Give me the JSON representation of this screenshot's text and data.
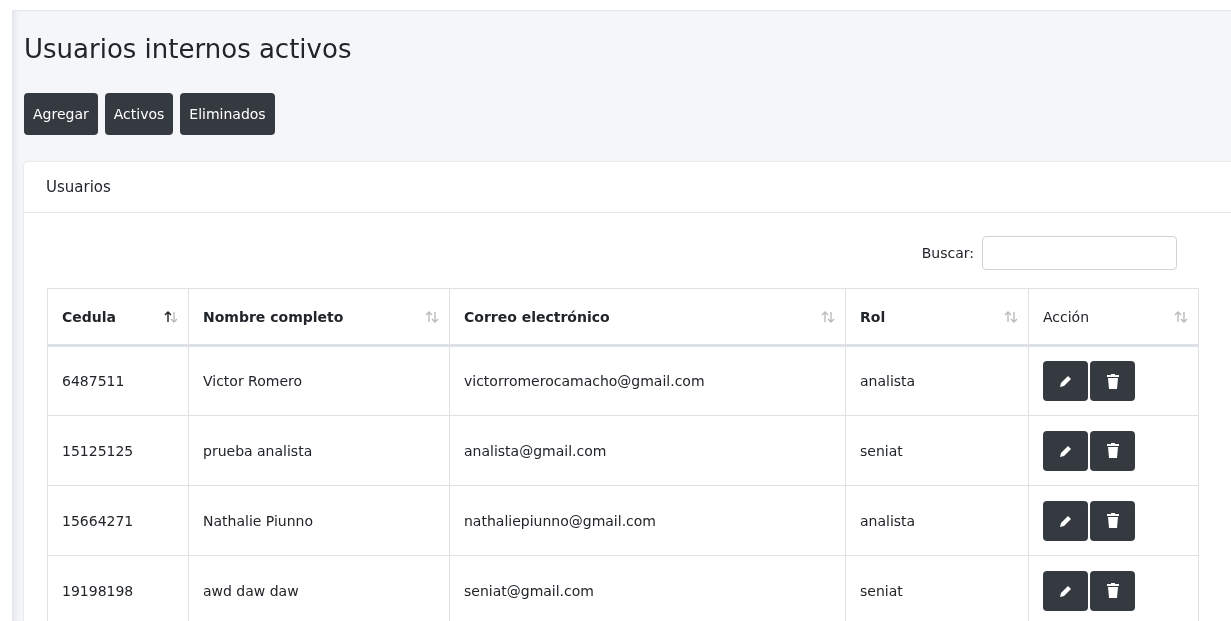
{
  "page_title": "Usuarios internos activos",
  "buttons": [
    "Agregar",
    "Activos",
    "Eliminados"
  ],
  "card": {
    "title": "Usuarios",
    "search": {
      "label": "Buscar:"
    },
    "table": {
      "columns": [
        {
          "label": "Cedula",
          "kind": "data",
          "sorted": true
        },
        {
          "label": "Nombre completo",
          "kind": "data",
          "sorted": false
        },
        {
          "label": "Correo electrónico",
          "kind": "data",
          "sorted": false
        },
        {
          "label": "Rol",
          "kind": "data",
          "sorted": false
        },
        {
          "label": "Acción",
          "kind": "action",
          "sorted": false
        }
      ],
      "rows": [
        {
          "cells": [
            "6487511",
            "Victor Romero",
            "victorromerocamacho@gmail.com",
            "analista"
          ]
        },
        {
          "cells": [
            "15125125",
            "prueba analista",
            "analista@gmail.com",
            "seniat"
          ]
        },
        {
          "cells": [
            "15664271",
            "Nathalie Piunno",
            "nathaliepiunno@gmail.com",
            "analista"
          ]
        },
        {
          "cells": [
            "19198198",
            "awd daw daw",
            "seniat@gmail.com",
            "seniat"
          ]
        }
      ]
    }
  }
}
